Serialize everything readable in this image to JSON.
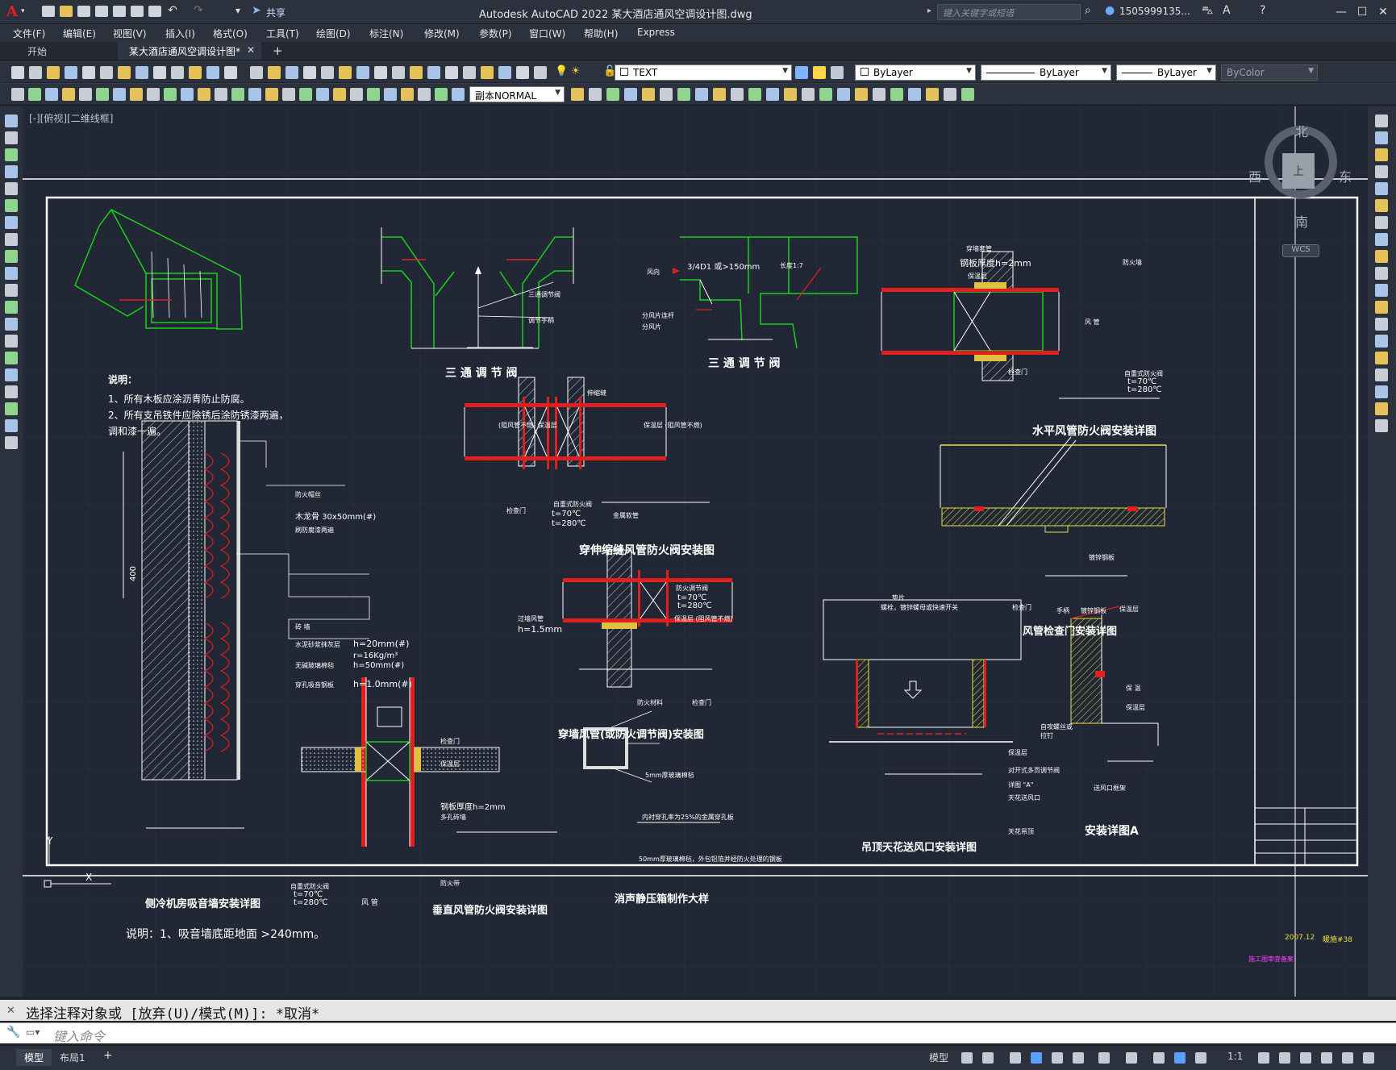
{
  "app": {
    "logo": "A",
    "title": "Autodesk AutoCAD 2022    某大酒店通风空调设计图.dwg",
    "share": "共享",
    "search_placeholder": "键入关键字或短语",
    "user": "1505999135...",
    "win_min": "—",
    "win_max": "☐",
    "win_close": "✕"
  },
  "menu": [
    "文件(F)",
    "编辑(E)",
    "视图(V)",
    "插入(I)",
    "格式(O)",
    "工具(T)",
    "绘图(D)",
    "标注(N)",
    "修改(M)",
    "参数(P)",
    "窗口(W)",
    "帮助(H)",
    "Express"
  ],
  "tabs": {
    "start": "开始",
    "doc": "某大酒店通风空调设计图*",
    "add": "+"
  },
  "toolbar1": {
    "layer": "TEXT",
    "color": "ByLayer",
    "linetype": "ByLayer",
    "lineweight": "ByLayer",
    "plotstyle": "ByColor"
  },
  "toolbar2": {
    "dimstyle": "副本NORMAL"
  },
  "viewport": {
    "label": "[-][俯视][二维线框]"
  },
  "viewcube": {
    "north": "北",
    "south": "南",
    "east": "东",
    "west": "西",
    "top": "上",
    "wcs": "WCS"
  },
  "command": {
    "history": "选择注释对象或 [放弃(U)/模式(M)]: *取消*",
    "placeholder": "键入命令"
  },
  "status": {
    "model_tab": "模型",
    "layout_tab": "布局1",
    "add": "+",
    "model_button": "模型",
    "scale": "1:1"
  },
  "drawing": {
    "t_valve_1": "三 通 调 节 阀",
    "t_valve_2": "三 通 调 节 阀",
    "t_valve_1_label1": "三通调节阀",
    "t_valve_1_label2": "调节手柄",
    "t_valve_2_dim1": "3/4D1 或>150mm",
    "t_valve_2_dim2": "长度1:7",
    "t_valve_2_l1": "风向",
    "t_valve_2_l2": "分风片连杆",
    "t_valve_2_l3": "分风片",
    "horiz_fd_title": "水平风管防火阀安装详图",
    "horiz_fd_l1": "穿墙套管",
    "horiz_fd_l2": "钢板厚度h=2mm",
    "horiz_fd_l3": "保温层",
    "horiz_fd_l4": "防火墙",
    "horiz_fd_l5": "风 管",
    "horiz_fd_l6": "检查门",
    "horiz_fd_l7": "自重式防火阀",
    "horiz_fd_l8": "t=70℃",
    "horiz_fd_l9": "t=280℃",
    "notes_title": "说明：",
    "notes_1": "1、所有木板应涂沥青防止防腐。",
    "notes_2": "2、所有支吊铁件应除锈后涂防锈漆两遍，",
    "notes_3": "调和漆一遍。",
    "expansion_title": "穿伸缩缝风管防火阀安装图",
    "expansion_l1": "伸缩缝",
    "expansion_l2": "(阻风管不燃) 保温层",
    "expansion_l3": "保温层 (阻风管不燃)",
    "expansion_l4": "检查门",
    "expansion_l5": "自重式防火阀",
    "expansion_l6": "t=70℃",
    "expansion_l7": "t=280℃",
    "expansion_l8": "金属软管",
    "wall_title": "侧冷机房吸音墙安装详图",
    "wall_note": "说明：1、吸音墙底距地面 >240mm。",
    "wall_l1": "防火帽丝",
    "wall_l2": "木龙骨 30x50mm(#)",
    "wall_l3": "刷防腐漆两遍",
    "wall_l4": "砖 墙",
    "wall_l5": "水泥砂浆抹灰层",
    "wall_l5v": "h=20mm(#)",
    "wall_l6": "无碱玻璃棉毡",
    "wall_l6v1": "r=16Kg/m³",
    "wall_l6v2": "h=50mm(#)",
    "wall_l7": "穿孔吸音钢板",
    "wall_l7v": "h=1.0mm(#)",
    "wall_dim": "400",
    "access_title": "风管检查门安装详图",
    "access_l1": "镀锌钢板",
    "access_l2": "垫片",
    "access_l3": "螺栓，镀锌螺母或快速开关",
    "access_l4": "检查门",
    "access_l5": "手柄",
    "access_l6": "镀锌钢板",
    "access_l7": "保温层",
    "wall_fd_title": "穿墙风管(或防火调节阀)安装图",
    "wall_fd_l1": "防火调节阀",
    "wall_fd_l2": "t=70℃",
    "wall_fd_l3": "t=280℃",
    "wall_fd_l4": "保温层 (阻风管不燃)",
    "wall_fd_l5": "过墙风管",
    "wall_fd_l6": "h=1.5mm",
    "wall_fd_l7": "防火材料",
    "wall_fd_l8": "检查门",
    "ceiling_title": "吊顶天花送风口安装详图",
    "ceiling_l1": "保温层",
    "ceiling_l2": "对开式多页调节阀",
    "ceiling_l3": "详图 \"A\"",
    "ceiling_l4": "天花送风口",
    "ceiling_l5": "天花吊顶",
    "detail_a_title": "安装详图A",
    "detail_a_l1": "保 温",
    "detail_a_l2": "保温层",
    "detail_a_l3": "自攻螺丝或拉钉",
    "detail_a_l4": "送风口框架",
    "vert_fd_title": "垂直风管防火阀安装详图",
    "vert_fd_l1": "检查门",
    "vert_fd_l2": "保温层",
    "vert_fd_l3": "钢板厚度h=2mm",
    "vert_fd_l4": "多孔砖墙",
    "vert_fd_l5": "防火带",
    "vert_fd_l6": "自重式防火阀",
    "vert_fd_l7": "t=70℃",
    "vert_fd_l8": "t=280℃",
    "vert_fd_l9": "风 管",
    "plenum_title": "消声静压箱制作大样",
    "plenum_l1": "5mm厚玻璃棉毡",
    "plenum_l2": "内衬穿孔率为25%的金属穿孔板",
    "plenum_l3": "50mm厚玻璃棉毡，外包铝箔并经防火处理的钢板",
    "titleblock_date": "2007.12",
    "titleblock_no": "暖施#38",
    "magenta_note": "施工图审查备案"
  }
}
